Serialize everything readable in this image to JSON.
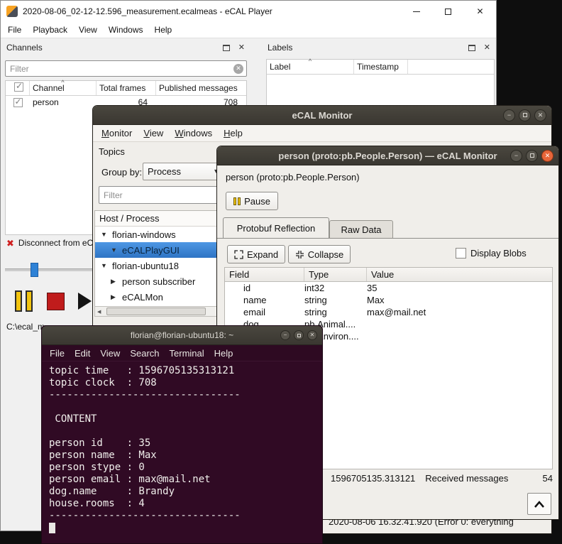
{
  "player": {
    "title": "2020-08-06_02-12-12.596_measurement.ecalmeas - eCAL Player",
    "menu": [
      "File",
      "Playback",
      "View",
      "Windows",
      "Help"
    ],
    "channels": {
      "title": "Channels",
      "filter_placeholder": "Filter",
      "columns": [
        "Channel",
        "Total frames",
        "Published messages"
      ],
      "row": {
        "channel": "person",
        "total_frames": "64",
        "published_messages": "708"
      },
      "disconnect_label": "Disconnect from eCA...",
      "path_label": "C:\\ecal_m"
    },
    "labels_panel": {
      "title": "Labels",
      "columns": [
        "Label",
        "Timestamp"
      ]
    }
  },
  "monitor": {
    "title": "eCAL Monitor",
    "menu": [
      "Monitor",
      "View",
      "Windows",
      "Help"
    ],
    "topics_title": "Topics",
    "group_by_label": "Group by:",
    "group_by_value": "Process",
    "filter_placeholder": "Filter",
    "tree_header": "Host / Process",
    "tree": [
      {
        "label": "florian-windows"
      },
      {
        "label": "eCALPlayGUI"
      },
      {
        "label": "florian-ubuntu18"
      },
      {
        "label": "person subscriber"
      },
      {
        "label": "eCALMon"
      }
    ],
    "log_line": "2020-08-06 16.32.41.920 (Error 0: everything"
  },
  "person": {
    "title": "person (proto:pb.People.Person) — eCAL Monitor",
    "heading": "person (proto:pb.People.Person)",
    "pause_label": "Pause",
    "tab_protobuf": "Protobuf Reflection",
    "tab_raw": "Raw Data",
    "expand_label": "Expand",
    "collapse_label": "Collapse",
    "display_blobs_label": "Display Blobs",
    "columns": [
      "Field",
      "Type",
      "Value"
    ],
    "rows": [
      {
        "field": "id",
        "type": "int32",
        "value": "35"
      },
      {
        "field": "name",
        "type": "string",
        "value": "Max"
      },
      {
        "field": "email",
        "type": "string",
        "value": "max@mail.net"
      },
      {
        "field": "dog",
        "type": "pb.Animal....",
        "value": ""
      },
      {
        "field": "",
        "type": "pb.Environ....",
        "value": ""
      }
    ],
    "status_timestamp": "1596705135.313121",
    "status_received_label": "Received messages",
    "status_received_count": "54"
  },
  "terminal": {
    "title": "florian@florian-ubuntu18: ~",
    "menu": [
      "File",
      "Edit",
      "View",
      "Search",
      "Terminal",
      "Help"
    ],
    "lines": [
      "topic time   : 1596705135313121",
      "topic clock  : 708",
      "--------------------------------",
      "",
      " CONTENT",
      "",
      "person id    : 35",
      "person name  : Max",
      "person stype : 0",
      "person email : max@mail.net",
      "dog.name     : Brandy",
      "house.rooms  : 4",
      "--------------------------------"
    ]
  },
  "colors": {
    "selection_blue": "#3c86d8",
    "terminal_bg": "#300a24",
    "close_button_orange": "#e8663a",
    "pause_yellow": "#f2c410",
    "stop_red": "#c01c1c",
    "slider_blue": "#2f82d6"
  }
}
